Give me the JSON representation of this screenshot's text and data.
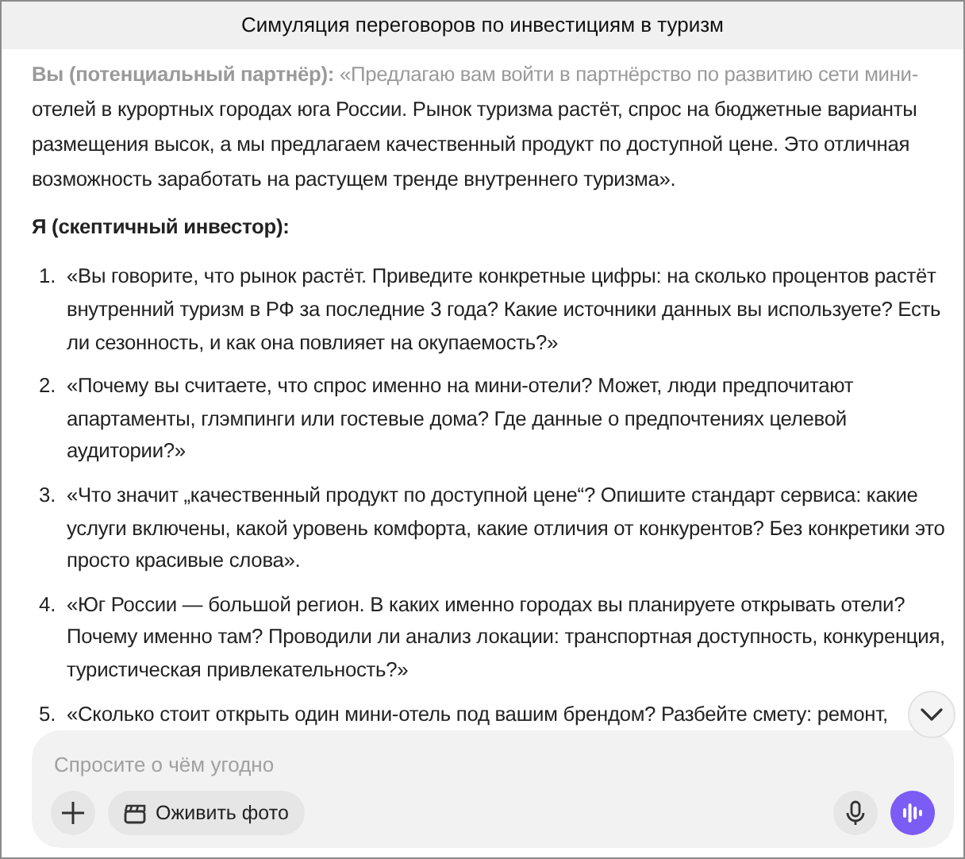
{
  "window": {
    "title": "Симуляция переговоров по инвестициям в туризм"
  },
  "intro": {
    "speaker": "Вы (потенциальный партнёр):",
    "text": "«Предлагаю вам войти в партнёрство по развитию сети мини-отелей в курортных городах юга России. Рынок туризма растёт, спрос на бюджетные варианты размещения высок, а мы предлагаем качественный продукт по доступной цене. Это отличная возможность заработать на растущем тренде внутреннего туризма»."
  },
  "reply_heading": "Я (скептичный инвестор):",
  "questions": [
    {
      "number": "1.",
      "text": "«Вы говорите, что рынок растёт. Приведите конкретные цифры: на сколько процентов растёт внутренний туризм в РФ за последние 3 года? Какие источники данных вы используете? Есть ли сезонность, и как она повлияет на окупаемость?»"
    },
    {
      "number": "2.",
      "text": "«Почему вы считаете, что спрос именно на мини-отели? Может, люди предпочитают апартаменты, глэмпинги или гостевые дома? Где данные о предпочтениях целевой аудитории?»"
    },
    {
      "number": "3.",
      "text": "«Что значит „качественный продукт по доступной цене“? Опишите стандарт сервиса: какие услуги включены, какой уровень комфорта, какие отличия от конкурентов? Без конкретики это просто красивые слова»."
    },
    {
      "number": "4.",
      "text": "«Юг России — большой регион. В каких именно городах вы планируете открывать отели? Почему именно там? Проводили ли анализ локации: транспортная доступность, конкуренция, туристическая привлекательность?»"
    },
    {
      "number": "5.",
      "text": "«Сколько стоит открыть один мини-отель под вашим брендом? Разбейте смету: ремонт,"
    }
  ],
  "composer": {
    "placeholder": "Спросите о чём угодно",
    "chip": "Оживить фото"
  }
}
